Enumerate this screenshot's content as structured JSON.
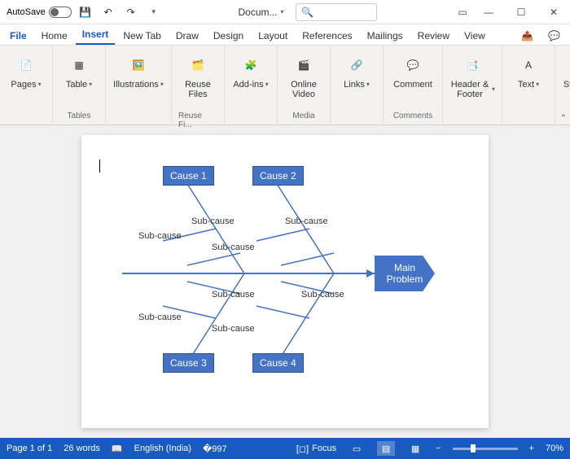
{
  "titlebar": {
    "autosave_label": "AutoSave",
    "doc_title": "Docum...",
    "search_placeholder": "Search"
  },
  "tabs": {
    "file": "File",
    "home": "Home",
    "insert": "Insert",
    "newtab": "New Tab",
    "draw": "Draw",
    "design": "Design",
    "layout": "Layout",
    "references": "References",
    "mailings": "Mailings",
    "review": "Review",
    "view": "View"
  },
  "ribbon": {
    "pages": "Pages",
    "table": "Table",
    "tables_group": "Tables",
    "illustrations": "Illustrations",
    "reuse_files": "Reuse Files",
    "reuse_group": "Reuse Fi...",
    "addins": "Add-ins",
    "online_video": "Online Video",
    "media_group": "Media",
    "links": "Links",
    "comment": "Comment",
    "comments_group": "Comments",
    "header_footer": "Header & Footer",
    "text": "Text",
    "symbols": "Symbols"
  },
  "diagram": {
    "cause1": "Cause 1",
    "cause2": "Cause 2",
    "cause3": "Cause 3",
    "cause4": "Cause 4",
    "sub": "Sub-cause",
    "main1": "Main",
    "main2": "Problem"
  },
  "status": {
    "page": "Page 1 of 1",
    "words": "26 words",
    "lang": "English (India)",
    "focus": "Focus",
    "zoom": "70%"
  }
}
